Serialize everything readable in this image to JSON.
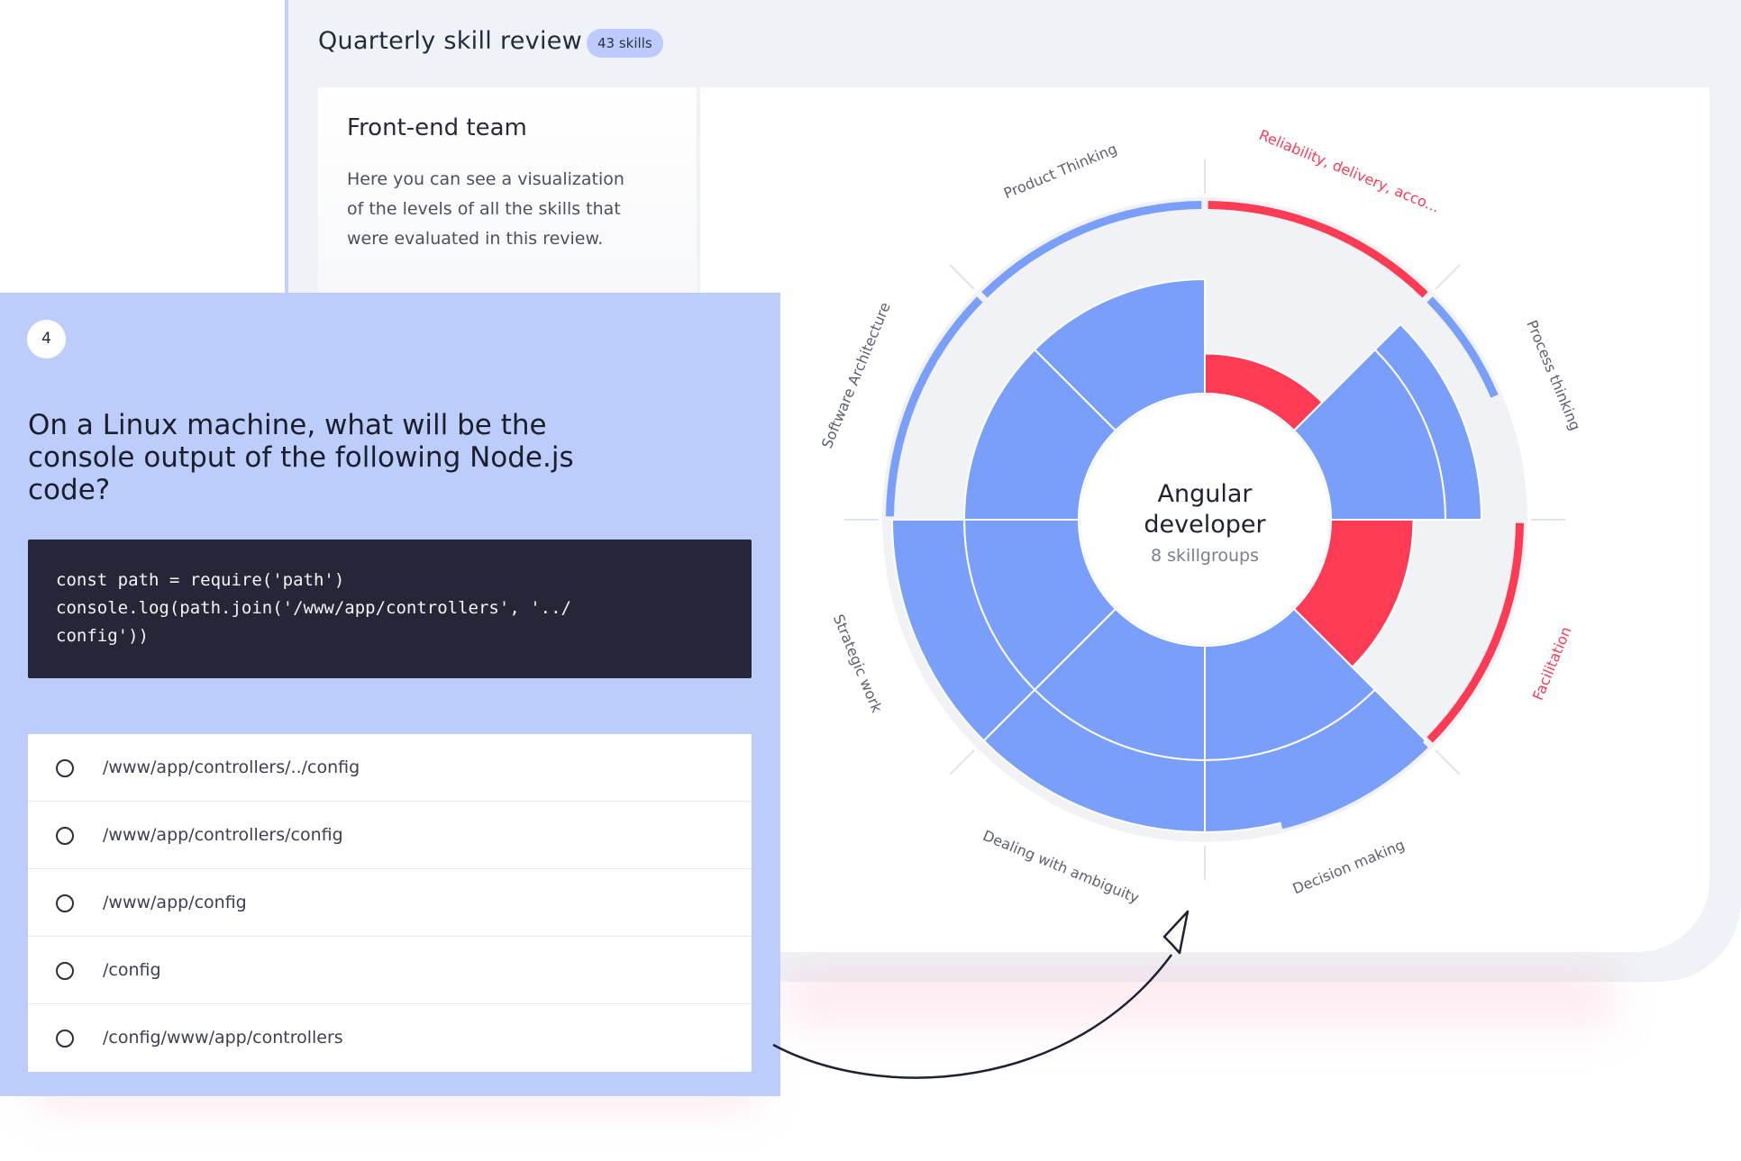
{
  "review": {
    "title": "Quarterly skill review",
    "skills_badge": "43 skills"
  },
  "team": {
    "title": "Front-end team",
    "description": "Here you can see a visualization of the levels of all the skills that were evaluated in this review."
  },
  "chart_data": {
    "type": "radial-bar",
    "center_title": "Angular developer",
    "center_subtitle": "8 skillgroups",
    "colors": {
      "normal": "#7a9ffb",
      "alert": "#fe3b55",
      "track": "#f0f2f6"
    },
    "segments": [
      {
        "label": "Reliability, delivery, acco...",
        "status": "alert",
        "inner": 0.35,
        "outer": 0.0,
        "ring": 1.0
      },
      {
        "label": "Process thinking",
        "status": "normal",
        "inner": 1.0,
        "outer": 0.5,
        "ring": 0.5
      },
      {
        "label": "Facilitation",
        "status": "alert",
        "inner": 0.72,
        "outer": 0.0,
        "ring": 1.0
      },
      {
        "label": "Decision making",
        "status": "normal",
        "inner": 1.0,
        "outer": 1.0,
        "ring": 0.7
      },
      {
        "label": "Dealing with ambiguity",
        "status": "normal",
        "inner": 1.0,
        "outer": 1.0,
        "ring": 0.0
      },
      {
        "label": "Strategic work",
        "status": "normal",
        "inner": 1.0,
        "outer": 1.0,
        "ring": 0.0
      },
      {
        "label": "Software Architecture",
        "status": "normal",
        "inner": 1.0,
        "outer": 0.0,
        "ring": 1.0
      },
      {
        "label": "Product Thinking",
        "status": "normal",
        "inner": 1.0,
        "outer": 0.0,
        "ring": 1.0
      }
    ]
  },
  "question": {
    "number": "4",
    "text": "On a Linux machine, what will be the console output of the following Node.js code?",
    "code": "const path = require('path')\nconsole.log(path.join('/www/app/controllers', '../\nconfig'))",
    "options": [
      "/www/app/controllers/../config",
      "/www/app/controllers/config",
      "/www/app/config",
      "/config",
      "/config/www/app/controllers"
    ]
  }
}
